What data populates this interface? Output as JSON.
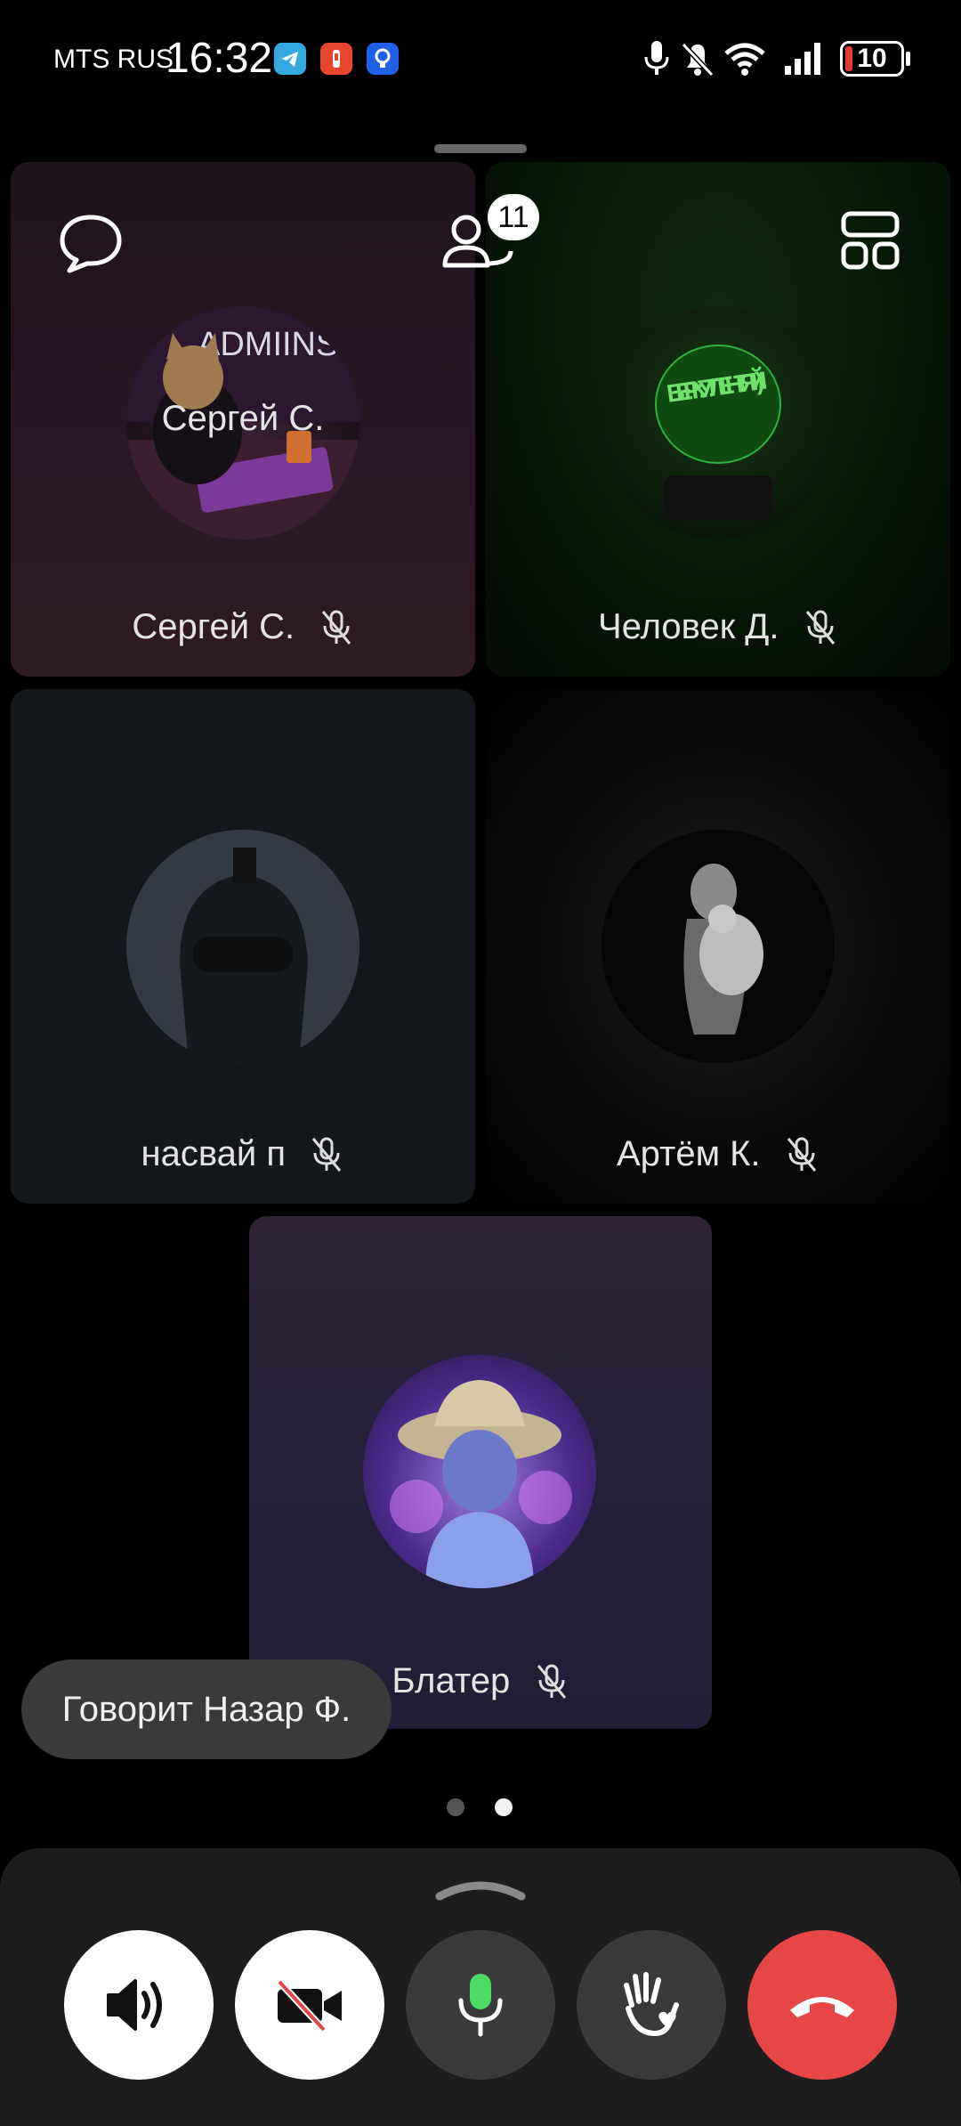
{
  "status_bar": {
    "carrier": "MTS RUS",
    "time": "16:32",
    "battery": "10"
  },
  "top_bar": {
    "participants_count": "11"
  },
  "participants": [
    {
      "name": "Сергей С.",
      "muted": true
    },
    {
      "name": "Человек Д.",
      "muted": true
    },
    {
      "name": "насвай п",
      "muted": true
    },
    {
      "name": "Артём К.",
      "muted": true
    },
    {
      "name": "Блатер",
      "muted": true
    }
  ],
  "avatar_text": {
    "sergey_sign": "ADMIINS",
    "chelovek_sign": "БЕРКУТ ЛЕНТЯЙ :)"
  },
  "speaking_toast": "Говорит Назар Ф.",
  "pagination": {
    "pages": 2,
    "current": 2
  },
  "controls": [
    {
      "name": "speaker",
      "icon": "speaker-icon"
    },
    {
      "name": "camera",
      "icon": "video-off-icon",
      "state": "off"
    },
    {
      "name": "microphone",
      "icon": "microphone-icon",
      "state": "on"
    },
    {
      "name": "raise-hand",
      "icon": "hand-heart-icon"
    },
    {
      "name": "end-call",
      "icon": "hang-up-icon"
    }
  ],
  "colors": {
    "background": "#000000",
    "end_call": "#e64646",
    "mic_active": "#4cd964",
    "control_white": "#ffffff",
    "control_dark": "#3a3a3a"
  }
}
